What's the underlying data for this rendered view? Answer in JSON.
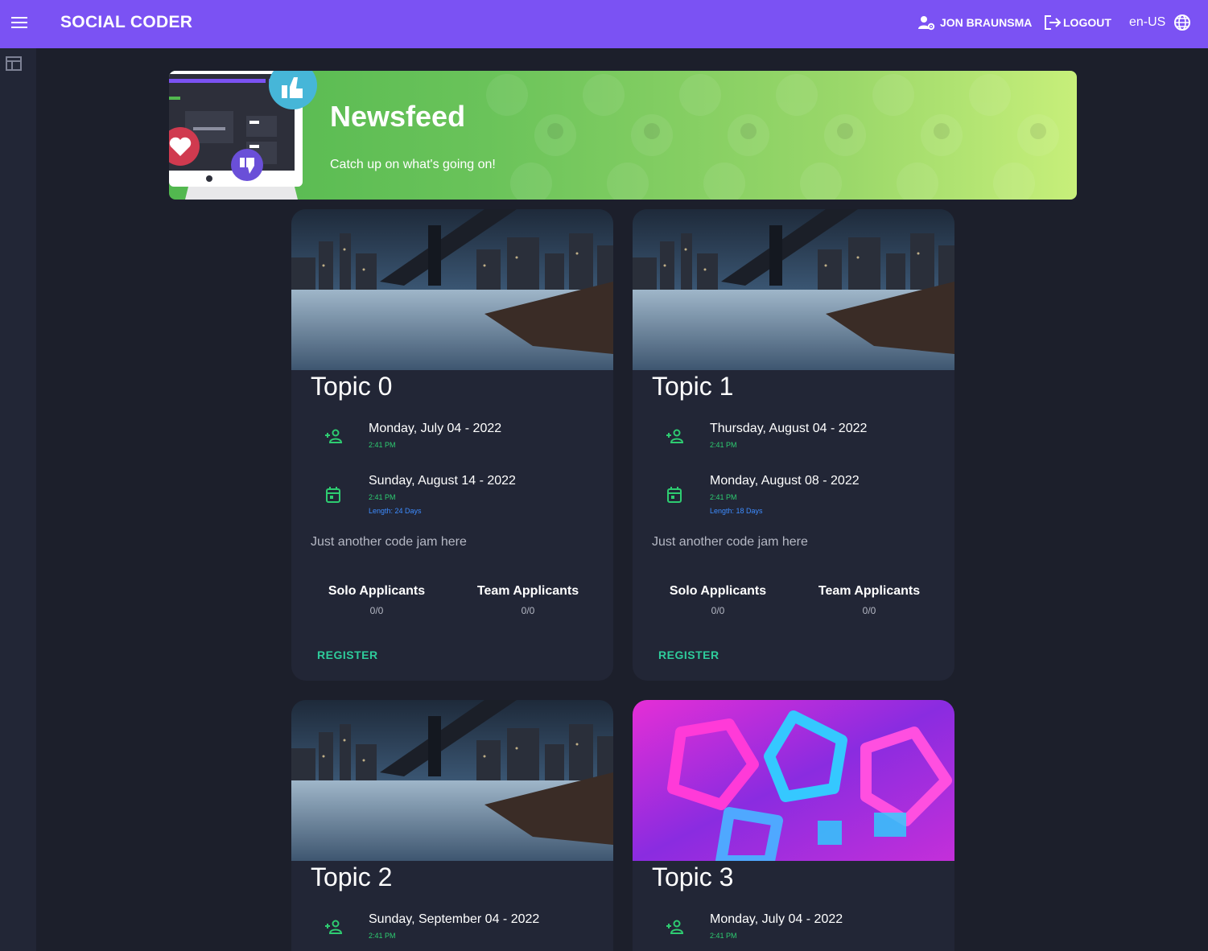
{
  "header": {
    "brand": "SOCIAL CODER",
    "user": "JON BRAUNSMA",
    "logout": "LOGOUT",
    "locale": "en-US"
  },
  "icons": {
    "menu": "menu-icon",
    "user": "user-gear-icon",
    "logout": "logout-icon",
    "locale": "globe-icon",
    "rail": "dashboard-icon",
    "start": "person-add-icon",
    "end": "calendar-icon",
    "like": "thumbs-up-icon",
    "dislike": "thumbs-down-icon",
    "heart": "heart-icon"
  },
  "colors": {
    "topbar": "#7b52f3",
    "background": "#1c1f2b",
    "card": "#222636",
    "accent_green": "#2ecc71",
    "length_blue": "#3e8cff",
    "register": "#2ecc9b"
  },
  "banner": {
    "title": "Newsfeed",
    "subtitle": "Catch up on what's going on!"
  },
  "cards": [
    {
      "title": "Topic 0",
      "image": "city-bridge-night",
      "start_date": "Monday, July 04 - 2022",
      "start_time": "2:41 PM",
      "end_date": "Sunday, August 14 - 2022",
      "end_time": "2:41 PM",
      "length": "Length: 24 Days",
      "description": "Just another code jam here",
      "solo_label": "Solo Applicants",
      "solo_value": "0/0",
      "team_label": "Team Applicants",
      "team_value": "0/0",
      "register": "REGISTER"
    },
    {
      "title": "Topic 1",
      "image": "city-bridge-night",
      "start_date": "Thursday, August 04 - 2022",
      "start_time": "2:41 PM",
      "end_date": "Monday, August 08 - 2022",
      "end_time": "2:41 PM",
      "length": "Length: 18 Days",
      "description": "Just another code jam here",
      "solo_label": "Solo Applicants",
      "solo_value": "0/0",
      "team_label": "Team Applicants",
      "team_value": "0/0",
      "register": "REGISTER"
    },
    {
      "title": "Topic 2",
      "image": "city-bridge-night",
      "start_date": "Sunday, September 04 - 2022",
      "start_time": "2:41 PM"
    },
    {
      "title": "Topic 3",
      "image": "abstract-neon-shapes",
      "start_date": "Monday, July 04 - 2022",
      "start_time": "2:41 PM"
    }
  ]
}
